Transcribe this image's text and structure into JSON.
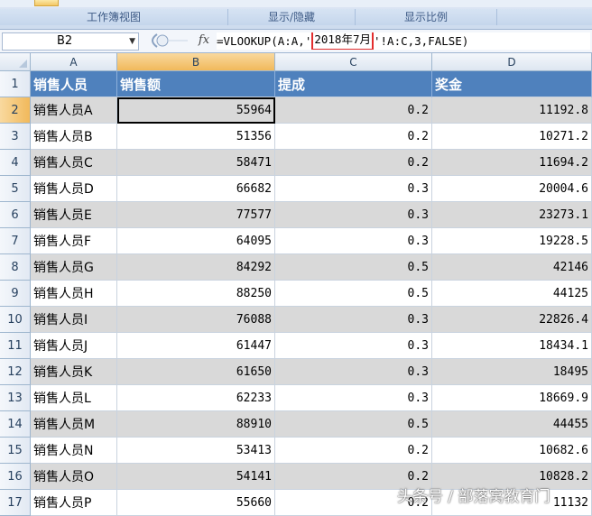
{
  "ribbon": {
    "groups": [
      {
        "label": "工作簿视图"
      },
      {
        "label": "显示/隐藏"
      },
      {
        "label": "显示比例"
      },
      {
        "label": ""
      }
    ]
  },
  "formula_bar": {
    "name_box": "B2",
    "fx_symbol": "fx",
    "formula_prefix": "=VLOOKUP(A:A,'",
    "formula_highlight": "2018年7月",
    "formula_suffix": "'!A:C,3,FALSE)"
  },
  "columns": [
    "A",
    "B",
    "C",
    "D"
  ],
  "headers": [
    "销售人员",
    "销售额",
    "提成",
    "奖金"
  ],
  "rows": [
    {
      "n": "1"
    },
    {
      "n": "2",
      "name": "销售人员A",
      "sales": "55964",
      "rate": "0.2",
      "bonus": "11192.8"
    },
    {
      "n": "3",
      "name": "销售人员B",
      "sales": "51356",
      "rate": "0.2",
      "bonus": "10271.2"
    },
    {
      "n": "4",
      "name": "销售人员C",
      "sales": "58471",
      "rate": "0.2",
      "bonus": "11694.2"
    },
    {
      "n": "5",
      "name": "销售人员D",
      "sales": "66682",
      "rate": "0.3",
      "bonus": "20004.6"
    },
    {
      "n": "6",
      "name": "销售人员E",
      "sales": "77577",
      "rate": "0.3",
      "bonus": "23273.1"
    },
    {
      "n": "7",
      "name": "销售人员F",
      "sales": "64095",
      "rate": "0.3",
      "bonus": "19228.5"
    },
    {
      "n": "8",
      "name": "销售人员G",
      "sales": "84292",
      "rate": "0.5",
      "bonus": "42146"
    },
    {
      "n": "9",
      "name": "销售人员H",
      "sales": "88250",
      "rate": "0.5",
      "bonus": "44125"
    },
    {
      "n": "10",
      "name": "销售人员I",
      "sales": "76088",
      "rate": "0.3",
      "bonus": "22826.4"
    },
    {
      "n": "11",
      "name": "销售人员J",
      "sales": "61447",
      "rate": "0.3",
      "bonus": "18434.1"
    },
    {
      "n": "12",
      "name": "销售人员K",
      "sales": "61650",
      "rate": "0.3",
      "bonus": "18495"
    },
    {
      "n": "13",
      "name": "销售人员L",
      "sales": "62233",
      "rate": "0.3",
      "bonus": "18669.9"
    },
    {
      "n": "14",
      "name": "销售人员M",
      "sales": "88910",
      "rate": "0.5",
      "bonus": "44455"
    },
    {
      "n": "15",
      "name": "销售人员N",
      "sales": "53413",
      "rate": "0.2",
      "bonus": "10682.6"
    },
    {
      "n": "16",
      "name": "销售人员O",
      "sales": "54141",
      "rate": "0.2",
      "bonus": "10828.2"
    },
    {
      "n": "17",
      "name": "销售人员P",
      "sales": "55660",
      "rate": "0.2",
      "bonus": "11132"
    }
  ],
  "watermark": "头条号 / 部落窝教育门",
  "colors": {
    "header_fill": "#4f81bd",
    "alt_row_fill": "#d9d9d9",
    "highlight_border": "#e32d2d",
    "selected_header": "#f1b95b"
  }
}
